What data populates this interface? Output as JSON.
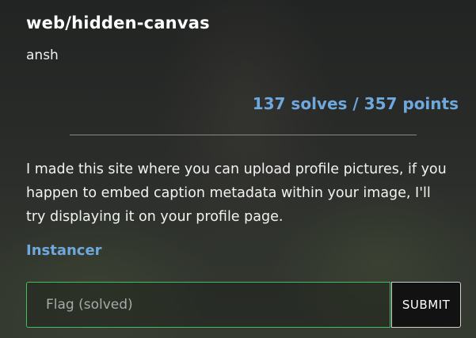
{
  "challenge": {
    "title": "web/hidden-canvas",
    "author": "ansh",
    "stats": "137 solves / 357 points",
    "description": "I made this site where you can upload profile pictures, if you happen to embed caption metadata within your image, I'll try displaying it on your profile page.",
    "link_label": "Instancer"
  },
  "flag_form": {
    "placeholder": "Flag (solved)",
    "value": "",
    "submit_label": "SUBMIT",
    "input_border_color": "#3fbf5f"
  },
  "colors": {
    "accent": "#6fa8dc",
    "text": "#f2f2f2"
  }
}
